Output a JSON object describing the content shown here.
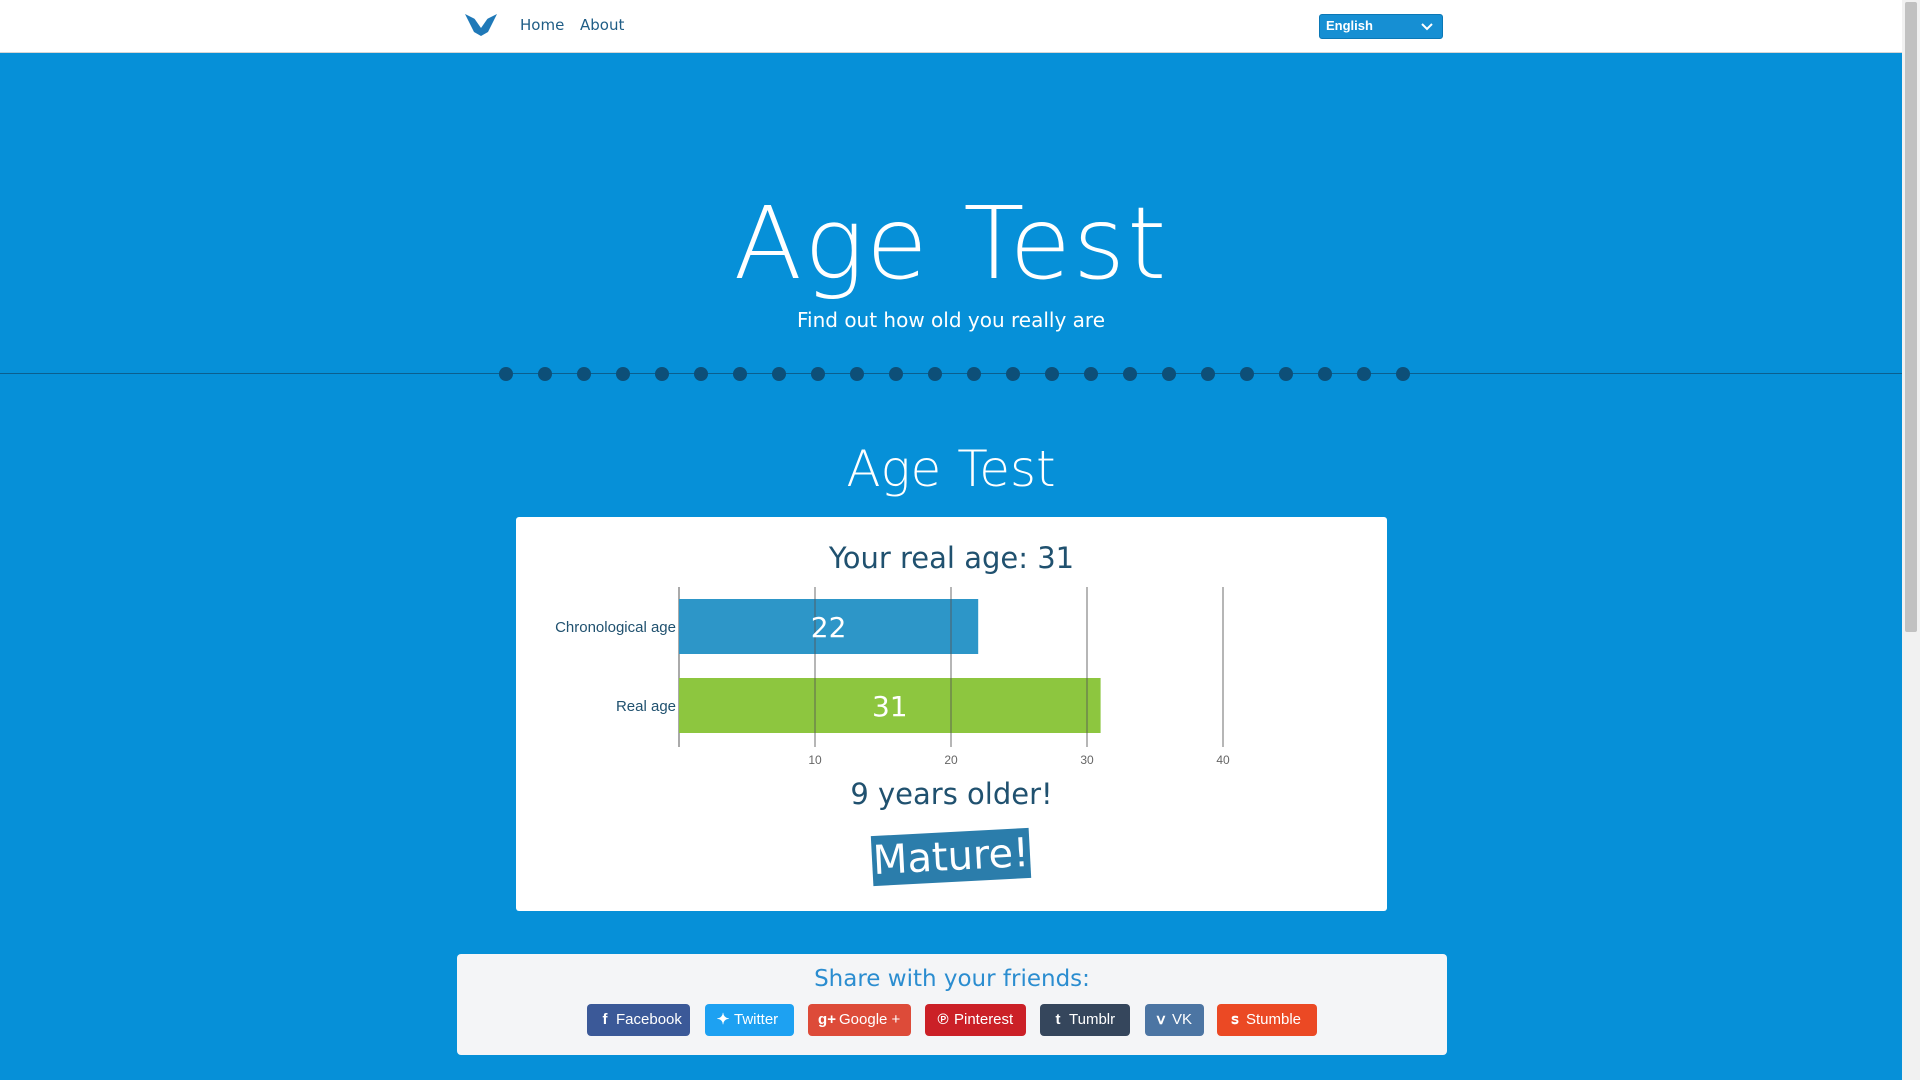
{
  "nav": {
    "home_label": "Home",
    "about_label": "About",
    "language": "English",
    "logo_icon": "bird-logo-icon"
  },
  "hero": {
    "title": "Age Test",
    "subtitle": "Find out how old you really are"
  },
  "section": {
    "title": "Age Test"
  },
  "result": {
    "title": "Your real age: 31",
    "difference": "9 years older!",
    "badge": "Mature!"
  },
  "chart_data": {
    "type": "bar",
    "orientation": "horizontal",
    "categories": [
      "Chronological age",
      "Real age"
    ],
    "values": [
      22,
      31
    ],
    "colors": [
      "#2d96c8",
      "#8dc63f"
    ],
    "data_labels": [
      "22",
      "31"
    ],
    "xlim": [
      0,
      40
    ],
    "xticks": [
      10,
      20,
      30,
      40
    ],
    "grid": true
  },
  "share": {
    "title": "Share with your friends:",
    "buttons": [
      {
        "label": "Facebook",
        "icon": "f",
        "color": "#3b5998"
      },
      {
        "label": "Twitter",
        "icon": "t",
        "color": "#1da1f2"
      },
      {
        "label": "Google +",
        "icon": "g+",
        "color": "#dd4b39"
      },
      {
        "label": "Pinterest",
        "icon": "P",
        "color": "#cb2027"
      },
      {
        "label": "Tumblr",
        "icon": "t",
        "color": "#35465c"
      },
      {
        "label": "VK",
        "icon": "vk",
        "color": "#4c75a3"
      },
      {
        "label": "Stumble",
        "icon": "su",
        "color": "#eb4924"
      }
    ]
  }
}
